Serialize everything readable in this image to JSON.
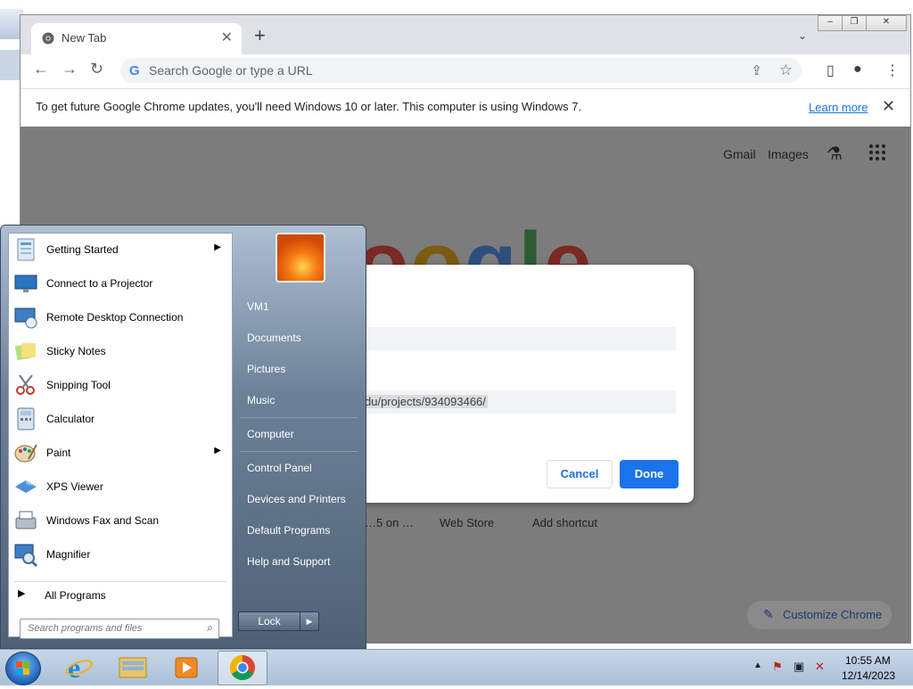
{
  "browser": {
    "tab_title": "New Tab",
    "omnibox_placeholder": "Search Google or type a URL",
    "infobar_message": "To get future Google Chrome updates, you'll need Windows 10 or later. This computer is using Windows 7.",
    "infobar_link": "Learn more",
    "header_links": [
      "Gmail",
      "Images"
    ],
    "logo_text": "Google",
    "shortcuts": [
      "…5 on …",
      "Web Store",
      "Add shortcut"
    ],
    "customize_label": "Customize Chrome"
  },
  "dialog": {
    "field1_value": "",
    "field2_value": "du/projects/934093466/",
    "cancel_label": "Cancel",
    "done_label": "Done"
  },
  "start_menu": {
    "programs": [
      {
        "label": "Getting Started",
        "has_submenu": true
      },
      {
        "label": "Connect to a Projector",
        "has_submenu": false
      },
      {
        "label": "Remote Desktop Connection",
        "has_submenu": false
      },
      {
        "label": "Sticky Notes",
        "has_submenu": false
      },
      {
        "label": "Snipping Tool",
        "has_submenu": false
      },
      {
        "label": "Calculator",
        "has_submenu": false
      },
      {
        "label": "Paint",
        "has_submenu": true
      },
      {
        "label": "XPS Viewer",
        "has_submenu": false
      },
      {
        "label": "Windows Fax and Scan",
        "has_submenu": false
      },
      {
        "label": "Magnifier",
        "has_submenu": false
      }
    ],
    "all_programs": "All Programs",
    "search_placeholder": "Search programs and files",
    "right_items": [
      "VM1",
      "Documents",
      "Pictures",
      "Music",
      "Computer",
      "Control Panel",
      "Devices and Printers",
      "Default Programs",
      "Help and Support"
    ],
    "lock_label": "Lock"
  },
  "taskbar": {
    "apps": [
      "internet-explorer",
      "windows-explorer",
      "media-player",
      "google-chrome"
    ],
    "clock_time": "10:55 AM",
    "clock_date": "12/14/2023"
  },
  "colors": {
    "accent": "#1a73e8",
    "overlay": "#7c7c7c",
    "taskbar": "#aabfd6"
  }
}
